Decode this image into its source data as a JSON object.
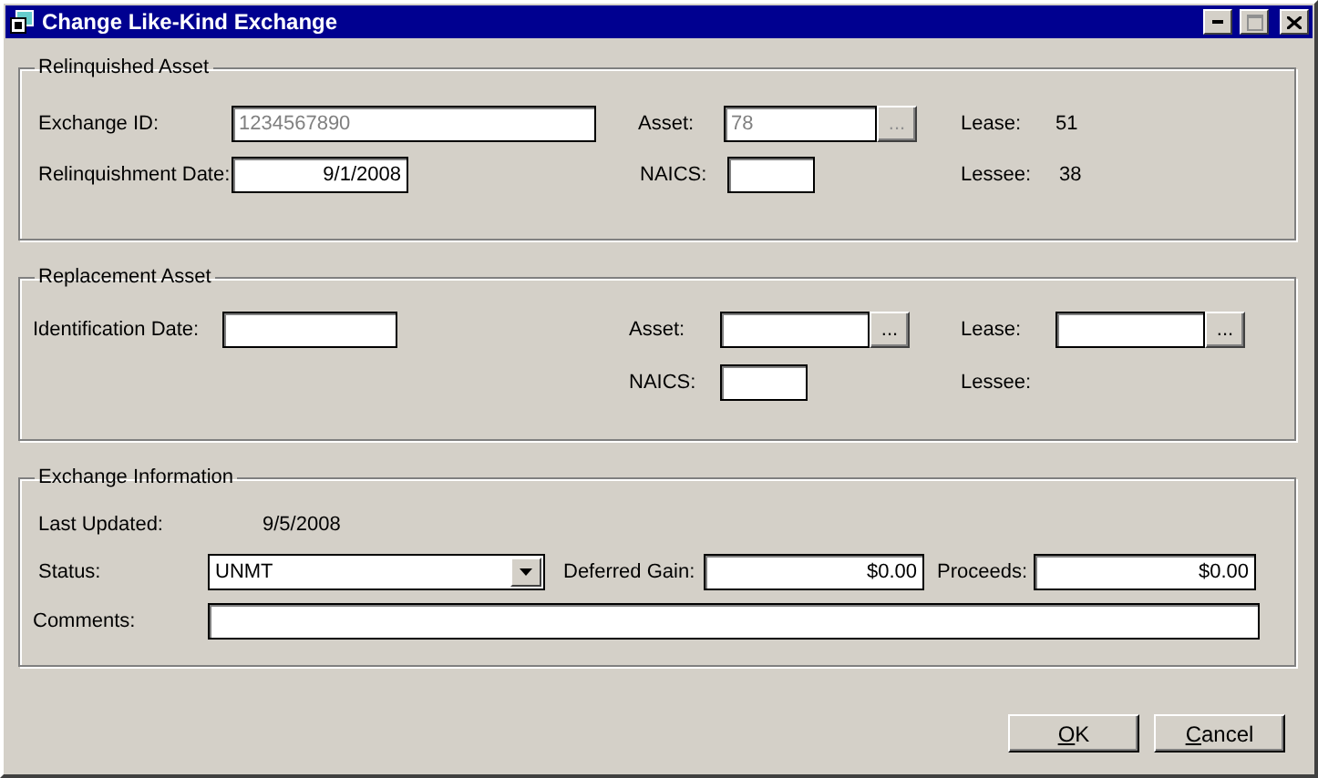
{
  "window": {
    "title": "Change Like-Kind Exchange"
  },
  "relinquished_asset": {
    "title": "Relinquished Asset",
    "exchange_id": {
      "label": "Exchange ID:",
      "value": "1234567890",
      "disabled": true
    },
    "relinquishment_date": {
      "label": "Relinquishment Date:",
      "value": "9/1/2008",
      "disabled": false
    },
    "asset": {
      "label": "Asset:",
      "value": "78",
      "disabled": true,
      "browse": "..."
    },
    "naics": {
      "label": "NAICS:"
    },
    "lease": {
      "label": "Lease:",
      "value": "51"
    },
    "lessee": {
      "label": "Lessee:",
      "value": "38"
    }
  },
  "replacement_asset": {
    "title": "Replacement Asset",
    "identification_date": {
      "label": "Identification Date:"
    },
    "asset": {
      "label": "Asset:",
      "browse": "..."
    },
    "naics": {
      "label": "NAICS:"
    },
    "lease": {
      "label": "Lease:",
      "browse": "..."
    },
    "lessee": {
      "label": "Lessee:"
    }
  },
  "exchange_information": {
    "title": "Exchange Information",
    "last_updated": {
      "label": "Last Updated:",
      "value": "9/5/2008"
    },
    "status": {
      "label": "Status:",
      "value": "UNMT"
    },
    "deferred_gain": {
      "label": "Deferred Gain:",
      "value": "$0.00",
      "disabled": false
    },
    "proceeds": {
      "label": "Proceeds:",
      "value": "$0.00",
      "disabled": false
    },
    "comments": {
      "label": "Comments:"
    }
  },
  "buttons": [
    {
      "label": "OK"
    },
    {
      "label": "Cancel"
    }
  ]
}
